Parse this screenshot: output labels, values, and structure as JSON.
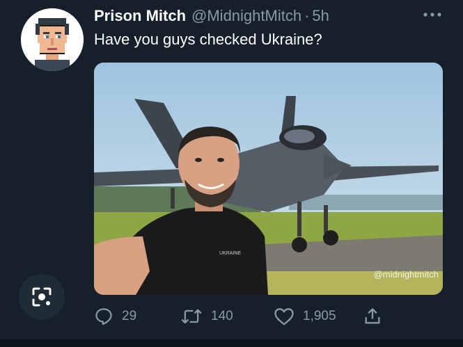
{
  "tweet": {
    "author_name": "Prison Mitch",
    "handle": "@MidnightMitch",
    "separator": "·",
    "time": "5h",
    "text": "Have you guys checked Ukraine?"
  },
  "media": {
    "watermark": "@midnightmitch",
    "shirt_text": "UKRAINE"
  },
  "actions": {
    "reply_count": "29",
    "retweet_count": "140",
    "like_count": "1,905"
  },
  "icons": {
    "more": "more-icon",
    "reply": "reply-icon",
    "retweet": "retweet-icon",
    "like": "heart-icon",
    "share": "share-icon",
    "lens": "lens-icon"
  },
  "colors": {
    "background": "#15202b",
    "secondary_text": "#8b98a5",
    "primary_text": "#ffffff"
  }
}
